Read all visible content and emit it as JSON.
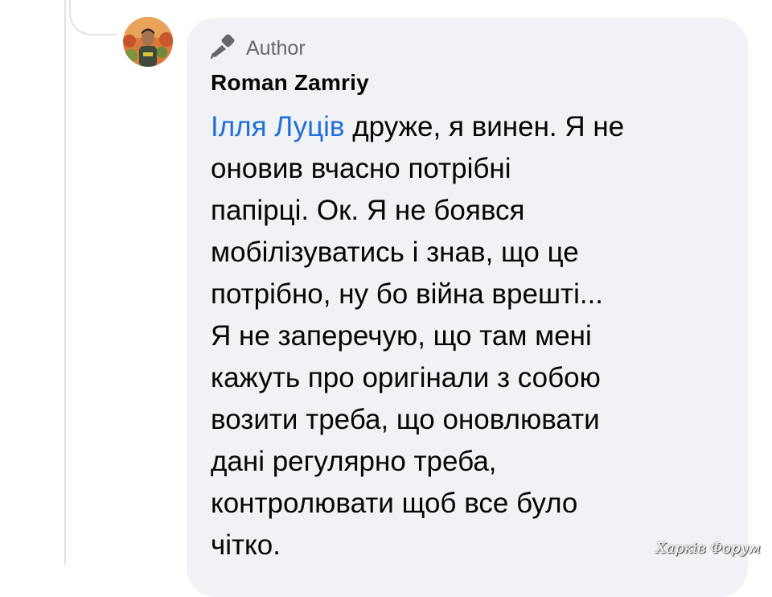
{
  "comment": {
    "badge_label": "Author",
    "author_name": "Roman Zamriy",
    "mention": "Ілля Луців",
    "lines": [
      " друже, я винен. Я не",
      "оновив вчасно потрібні",
      "папірці. Ок. Я не боявся",
      "мобілізуватись і знав, що це",
      "потрібно, ну бо війна врешті...",
      "Я не заперечую, що там мені",
      "кажуть про оригінали з собою",
      "возити треба, що оновлювати",
      "дані регулярно треба,",
      "контролювати щоб все було",
      "чітко."
    ]
  },
  "watermark": "Харків Форум",
  "colors": {
    "bubble": "#f0f2f5",
    "mention": "#216fdb",
    "text": "#050505",
    "secondary": "#65676b"
  },
  "icons": {
    "badge": "microphone-icon"
  }
}
